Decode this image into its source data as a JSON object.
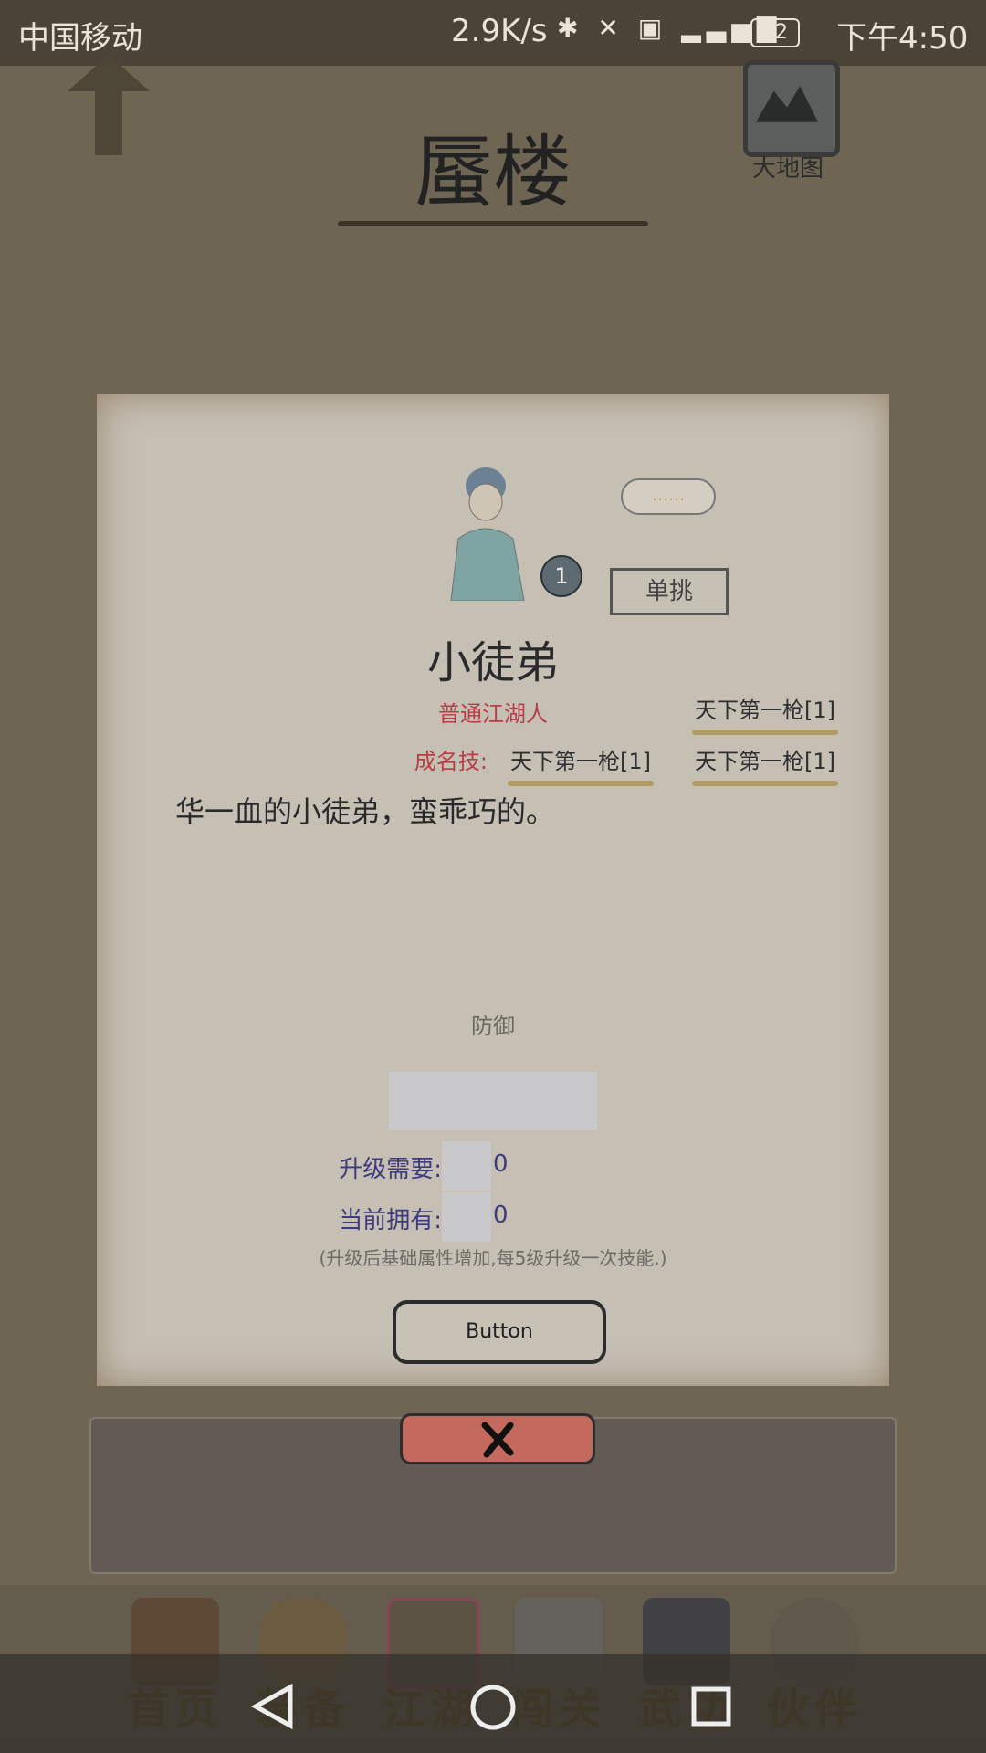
{
  "status_bar": {
    "carrier": "中国移动",
    "network_speed": "2.9K/s",
    "icons": [
      "bluetooth-icon",
      "mute-icon",
      "hd-icon",
      "signal-4g-icon"
    ],
    "battery": "62",
    "time": "下午4:50"
  },
  "header": {
    "title": "蜃楼",
    "world_map_label": "大地图"
  },
  "npc": {
    "bubble_text": "……",
    "level": "1",
    "duel_label": "单挑",
    "name": "小徒弟",
    "rank": "普通江湖人",
    "signature_label": "成名技:",
    "skills": {
      "top_right": "天下第一枪[1]",
      "mid_left": "天下第一枪[1]",
      "mid_right": "天下第一枪[1]"
    },
    "description": "华一血的小徒弟，蛮乖巧的。",
    "stat_label": "防御"
  },
  "upgrade": {
    "cost_label": "升级需要:",
    "cost_value": "0",
    "owned_label": "当前拥有:",
    "owned_value": "0",
    "hint": "(升级后基础属性增加,每5级升级一次技能.)",
    "button_label": "Button"
  },
  "bottom_nav": [
    {
      "label": "首页",
      "icon": "home-icon"
    },
    {
      "label": "装备",
      "icon": "armor-icon"
    },
    {
      "label": "江湖",
      "icon": "scroll-icon"
    },
    {
      "label": "闯关",
      "icon": "crossed-swords-icon"
    },
    {
      "label": "武功",
      "icon": "book-icon"
    },
    {
      "label": "伙伴",
      "icon": "partners-icon"
    }
  ],
  "colors": {
    "accent_red": "#b83d46",
    "ink_blue": "#3f3a7c",
    "close_button": "#c4695d"
  }
}
